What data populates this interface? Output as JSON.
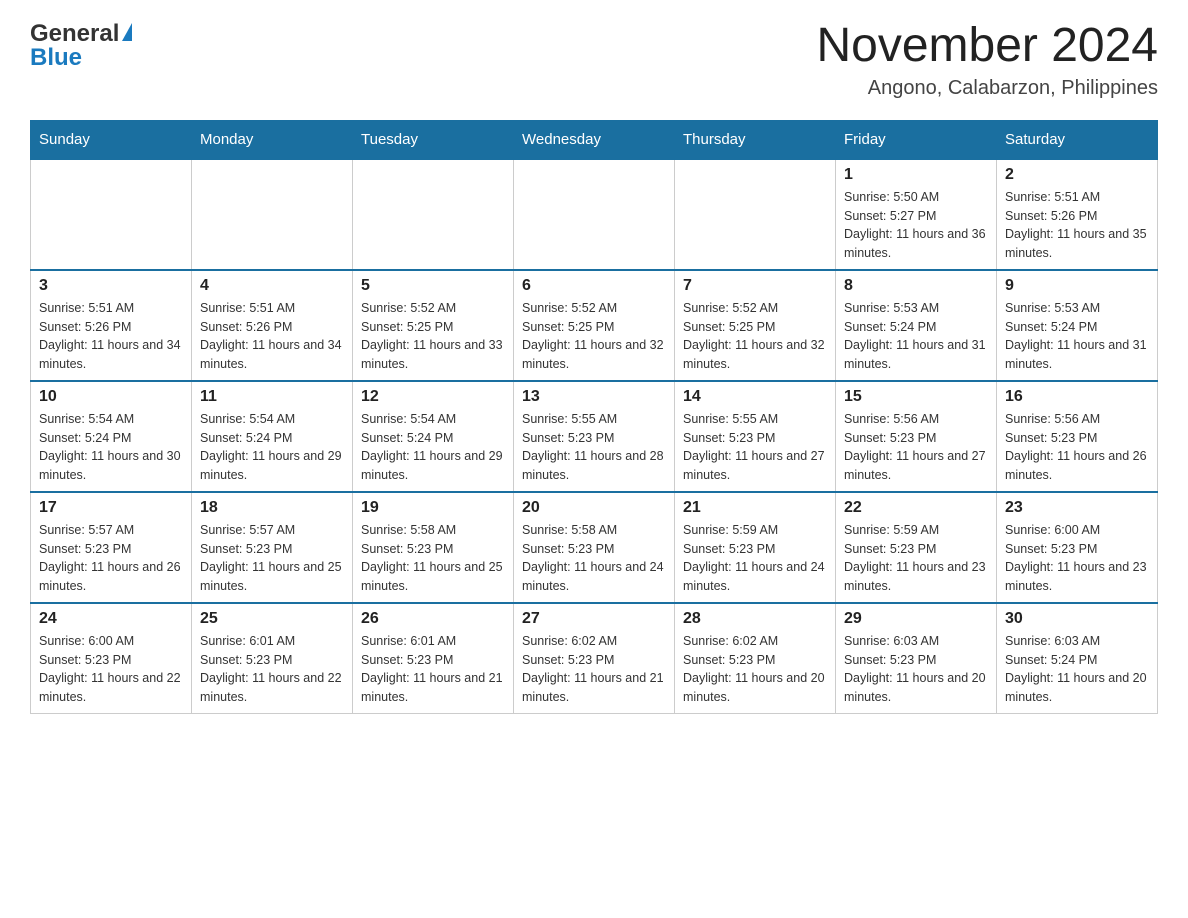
{
  "logo": {
    "text_general": "General",
    "text_blue": "Blue",
    "triangle": "▶"
  },
  "title": {
    "month_year": "November 2024",
    "location": "Angono, Calabarzon, Philippines"
  },
  "days_of_week": [
    "Sunday",
    "Monday",
    "Tuesday",
    "Wednesday",
    "Thursday",
    "Friday",
    "Saturday"
  ],
  "weeks": [
    {
      "days": [
        {
          "number": "",
          "sunrise": "",
          "sunset": "",
          "daylight": "",
          "empty": true
        },
        {
          "number": "",
          "sunrise": "",
          "sunset": "",
          "daylight": "",
          "empty": true
        },
        {
          "number": "",
          "sunrise": "",
          "sunset": "",
          "daylight": "",
          "empty": true
        },
        {
          "number": "",
          "sunrise": "",
          "sunset": "",
          "daylight": "",
          "empty": true
        },
        {
          "number": "",
          "sunrise": "",
          "sunset": "",
          "daylight": "",
          "empty": true
        },
        {
          "number": "1",
          "sunrise": "Sunrise: 5:50 AM",
          "sunset": "Sunset: 5:27 PM",
          "daylight": "Daylight: 11 hours and 36 minutes.",
          "empty": false
        },
        {
          "number": "2",
          "sunrise": "Sunrise: 5:51 AM",
          "sunset": "Sunset: 5:26 PM",
          "daylight": "Daylight: 11 hours and 35 minutes.",
          "empty": false
        }
      ]
    },
    {
      "days": [
        {
          "number": "3",
          "sunrise": "Sunrise: 5:51 AM",
          "sunset": "Sunset: 5:26 PM",
          "daylight": "Daylight: 11 hours and 34 minutes.",
          "empty": false
        },
        {
          "number": "4",
          "sunrise": "Sunrise: 5:51 AM",
          "sunset": "Sunset: 5:26 PM",
          "daylight": "Daylight: 11 hours and 34 minutes.",
          "empty": false
        },
        {
          "number": "5",
          "sunrise": "Sunrise: 5:52 AM",
          "sunset": "Sunset: 5:25 PM",
          "daylight": "Daylight: 11 hours and 33 minutes.",
          "empty": false
        },
        {
          "number": "6",
          "sunrise": "Sunrise: 5:52 AM",
          "sunset": "Sunset: 5:25 PM",
          "daylight": "Daylight: 11 hours and 32 minutes.",
          "empty": false
        },
        {
          "number": "7",
          "sunrise": "Sunrise: 5:52 AM",
          "sunset": "Sunset: 5:25 PM",
          "daylight": "Daylight: 11 hours and 32 minutes.",
          "empty": false
        },
        {
          "number": "8",
          "sunrise": "Sunrise: 5:53 AM",
          "sunset": "Sunset: 5:24 PM",
          "daylight": "Daylight: 11 hours and 31 minutes.",
          "empty": false
        },
        {
          "number": "9",
          "sunrise": "Sunrise: 5:53 AM",
          "sunset": "Sunset: 5:24 PM",
          "daylight": "Daylight: 11 hours and 31 minutes.",
          "empty": false
        }
      ]
    },
    {
      "days": [
        {
          "number": "10",
          "sunrise": "Sunrise: 5:54 AM",
          "sunset": "Sunset: 5:24 PM",
          "daylight": "Daylight: 11 hours and 30 minutes.",
          "empty": false
        },
        {
          "number": "11",
          "sunrise": "Sunrise: 5:54 AM",
          "sunset": "Sunset: 5:24 PM",
          "daylight": "Daylight: 11 hours and 29 minutes.",
          "empty": false
        },
        {
          "number": "12",
          "sunrise": "Sunrise: 5:54 AM",
          "sunset": "Sunset: 5:24 PM",
          "daylight": "Daylight: 11 hours and 29 minutes.",
          "empty": false
        },
        {
          "number": "13",
          "sunrise": "Sunrise: 5:55 AM",
          "sunset": "Sunset: 5:23 PM",
          "daylight": "Daylight: 11 hours and 28 minutes.",
          "empty": false
        },
        {
          "number": "14",
          "sunrise": "Sunrise: 5:55 AM",
          "sunset": "Sunset: 5:23 PM",
          "daylight": "Daylight: 11 hours and 27 minutes.",
          "empty": false
        },
        {
          "number": "15",
          "sunrise": "Sunrise: 5:56 AM",
          "sunset": "Sunset: 5:23 PM",
          "daylight": "Daylight: 11 hours and 27 minutes.",
          "empty": false
        },
        {
          "number": "16",
          "sunrise": "Sunrise: 5:56 AM",
          "sunset": "Sunset: 5:23 PM",
          "daylight": "Daylight: 11 hours and 26 minutes.",
          "empty": false
        }
      ]
    },
    {
      "days": [
        {
          "number": "17",
          "sunrise": "Sunrise: 5:57 AM",
          "sunset": "Sunset: 5:23 PM",
          "daylight": "Daylight: 11 hours and 26 minutes.",
          "empty": false
        },
        {
          "number": "18",
          "sunrise": "Sunrise: 5:57 AM",
          "sunset": "Sunset: 5:23 PM",
          "daylight": "Daylight: 11 hours and 25 minutes.",
          "empty": false
        },
        {
          "number": "19",
          "sunrise": "Sunrise: 5:58 AM",
          "sunset": "Sunset: 5:23 PM",
          "daylight": "Daylight: 11 hours and 25 minutes.",
          "empty": false
        },
        {
          "number": "20",
          "sunrise": "Sunrise: 5:58 AM",
          "sunset": "Sunset: 5:23 PM",
          "daylight": "Daylight: 11 hours and 24 minutes.",
          "empty": false
        },
        {
          "number": "21",
          "sunrise": "Sunrise: 5:59 AM",
          "sunset": "Sunset: 5:23 PM",
          "daylight": "Daylight: 11 hours and 24 minutes.",
          "empty": false
        },
        {
          "number": "22",
          "sunrise": "Sunrise: 5:59 AM",
          "sunset": "Sunset: 5:23 PM",
          "daylight": "Daylight: 11 hours and 23 minutes.",
          "empty": false
        },
        {
          "number": "23",
          "sunrise": "Sunrise: 6:00 AM",
          "sunset": "Sunset: 5:23 PM",
          "daylight": "Daylight: 11 hours and 23 minutes.",
          "empty": false
        }
      ]
    },
    {
      "days": [
        {
          "number": "24",
          "sunrise": "Sunrise: 6:00 AM",
          "sunset": "Sunset: 5:23 PM",
          "daylight": "Daylight: 11 hours and 22 minutes.",
          "empty": false
        },
        {
          "number": "25",
          "sunrise": "Sunrise: 6:01 AM",
          "sunset": "Sunset: 5:23 PM",
          "daylight": "Daylight: 11 hours and 22 minutes.",
          "empty": false
        },
        {
          "number": "26",
          "sunrise": "Sunrise: 6:01 AM",
          "sunset": "Sunset: 5:23 PM",
          "daylight": "Daylight: 11 hours and 21 minutes.",
          "empty": false
        },
        {
          "number": "27",
          "sunrise": "Sunrise: 6:02 AM",
          "sunset": "Sunset: 5:23 PM",
          "daylight": "Daylight: 11 hours and 21 minutes.",
          "empty": false
        },
        {
          "number": "28",
          "sunrise": "Sunrise: 6:02 AM",
          "sunset": "Sunset: 5:23 PM",
          "daylight": "Daylight: 11 hours and 20 minutes.",
          "empty": false
        },
        {
          "number": "29",
          "sunrise": "Sunrise: 6:03 AM",
          "sunset": "Sunset: 5:23 PM",
          "daylight": "Daylight: 11 hours and 20 minutes.",
          "empty": false
        },
        {
          "number": "30",
          "sunrise": "Sunrise: 6:03 AM",
          "sunset": "Sunset: 5:24 PM",
          "daylight": "Daylight: 11 hours and 20 minutes.",
          "empty": false
        }
      ]
    }
  ]
}
